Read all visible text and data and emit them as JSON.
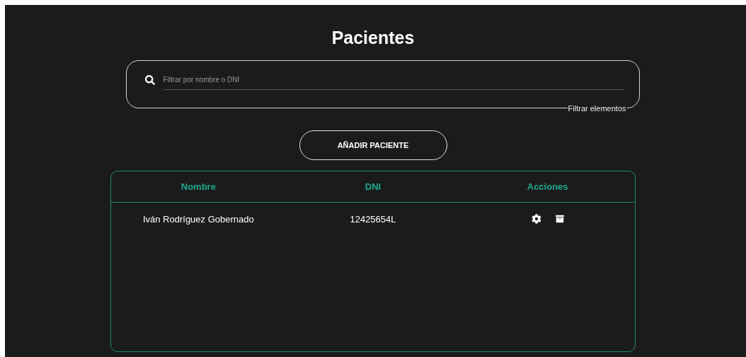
{
  "title": "Pacientes",
  "filter": {
    "placeholder": "Filtrar por nombre o DNI",
    "legend": "Filtrar elementos"
  },
  "add_button": "AÑADIR PACIENTE",
  "table": {
    "columns": [
      "Nombre",
      "DNI",
      "Acciones"
    ],
    "rows": [
      {
        "name": "Iván Rodríguez Gobernado",
        "dni": "12425654L",
        "actions": [
          {
            "kind": "settings"
          },
          {
            "kind": "delete"
          }
        ]
      }
    ]
  }
}
